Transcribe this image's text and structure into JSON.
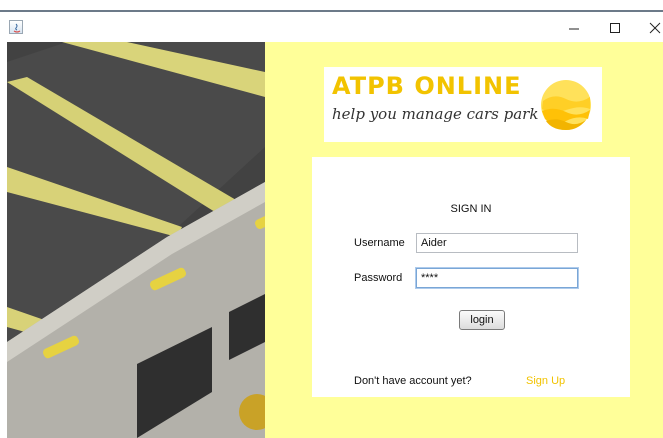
{
  "window": {
    "icon": "java-app-icon",
    "controls": [
      "minimize-icon",
      "maximize-icon",
      "close-icon"
    ]
  },
  "logo": {
    "title": "ATPB ONLINE",
    "tagline": "help you manage cars park",
    "icon": "sun-waves-icon"
  },
  "form": {
    "title": "SIGN IN",
    "username_label": "Username",
    "username_value": "Aider",
    "password_label": "Password",
    "password_value": "****",
    "login_label": "login",
    "signup_prompt": "Don't have account yet?",
    "signup_link": "Sign Up"
  },
  "colors": {
    "background": "#ffff99",
    "accent": "#f2c300",
    "panel": "#ffffff"
  }
}
